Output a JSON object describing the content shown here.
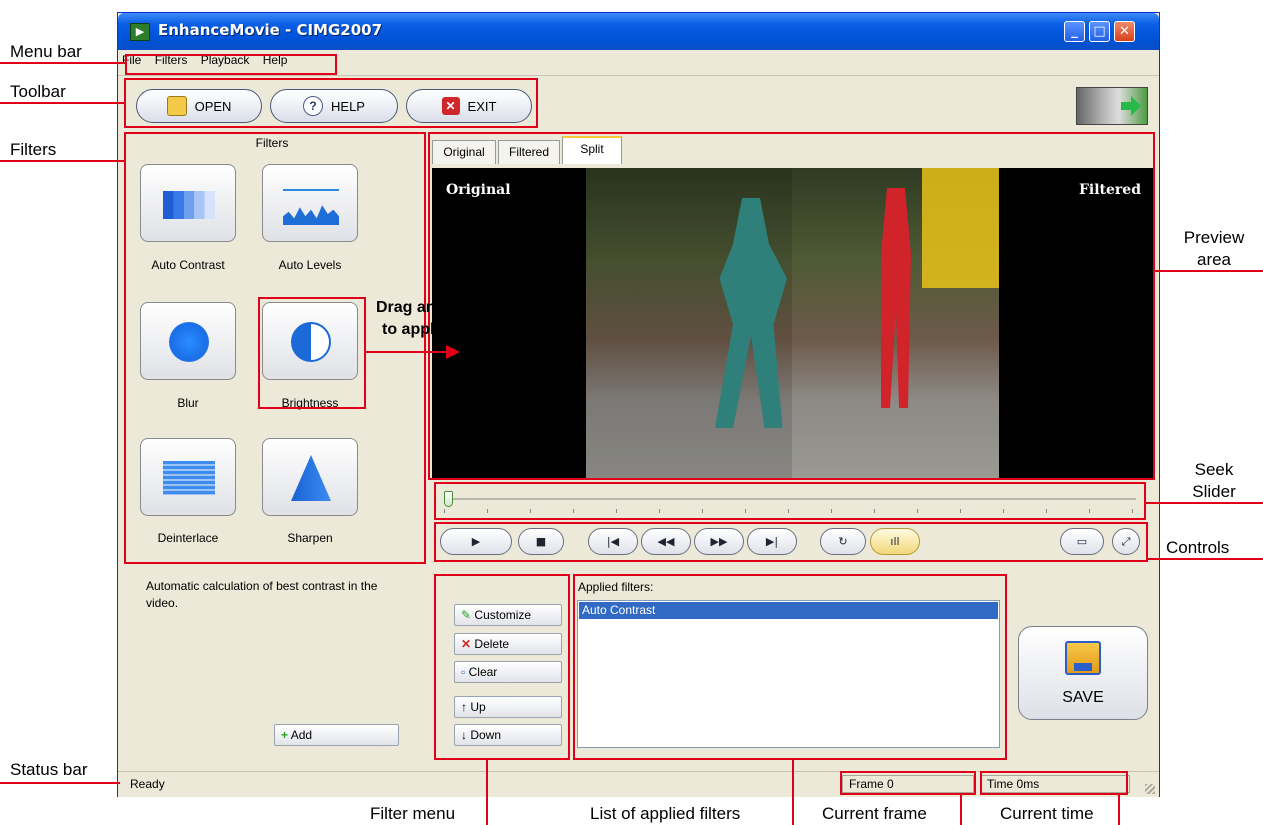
{
  "window": {
    "title": "EnhanceMovie - CIMG2007",
    "controls": {
      "minimize": "_",
      "maximize": "□",
      "close": "✕"
    }
  },
  "menu": [
    "File",
    "Filters",
    "Playback",
    "Help"
  ],
  "toolbar": {
    "open": "OPEN",
    "help": "HELP",
    "exit": "EXIT",
    "help_glyph": "?",
    "exit_glyph": "✕"
  },
  "filters_panel": {
    "title": "Filters",
    "items": [
      "Auto Contrast",
      "Auto Levels",
      "Blur",
      "Brightness",
      "Deinterlace",
      "Sharpen"
    ]
  },
  "description": "Automatic calculation of best contrast in the video.",
  "add_button": "Add",
  "preview": {
    "tabs": [
      "Original",
      "Filtered",
      "Split"
    ],
    "active_tab": "Split",
    "label_left": "Original",
    "label_right": "Filtered"
  },
  "seek_position": 0,
  "filter_menu": {
    "customize": "Customize",
    "delete": "Delete",
    "clear": "Clear",
    "up": "Up",
    "down": "Down"
  },
  "applied_filters": {
    "label": "Applied filters:",
    "items": [
      "Auto Contrast"
    ]
  },
  "save_button": "SAVE",
  "status": {
    "text": "Ready",
    "frame": "Frame 0",
    "time": "Time 0ms"
  },
  "annotations": {
    "menu_bar": "Menu bar",
    "toolbar": "Toolbar",
    "filters": "Filters",
    "status_bar": "Status bar",
    "preview_area_1": "Preview",
    "preview_area_2": "area",
    "seek_slider_1": "Seek",
    "seek_slider_2": "Slider",
    "controls": "Controls",
    "drag_1": "Drag and drop",
    "drag_2": "to apply filter",
    "filter_menu": "Filter menu",
    "applied_list": "List of applied filters",
    "current_frame": "Current frame",
    "current_time": "Current time"
  },
  "colors": {
    "accent_red": "#e0001a",
    "selection": "#316ac5",
    "titlebar": "#0a5fe5"
  }
}
